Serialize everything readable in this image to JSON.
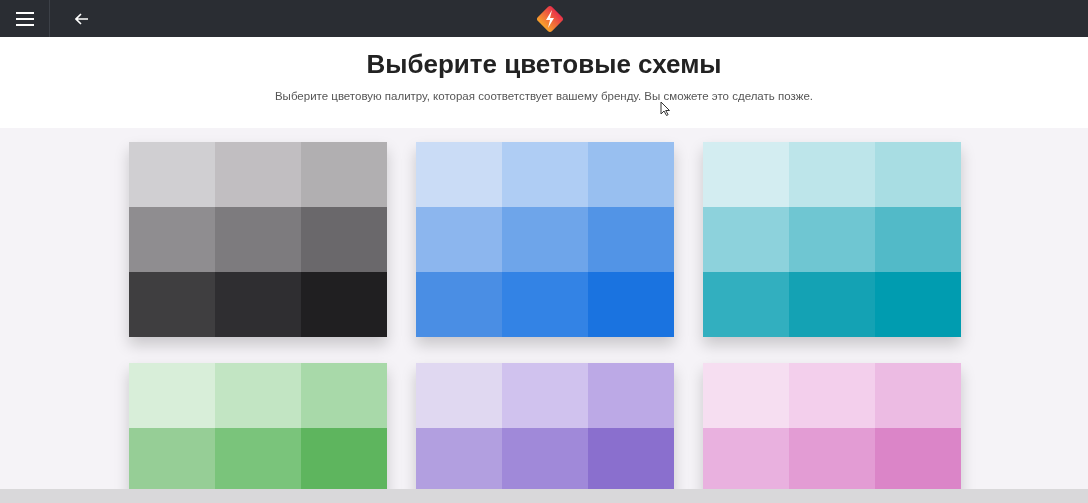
{
  "header": {
    "title": "Выберите цветовые схемы",
    "subtitle": "Выберите цветовую палитру, которая соответствует вашему бренду. Вы сможете это сделать позже."
  },
  "palettes": [
    {
      "rows": [
        [
          {
            "color": "#d0cfd2"
          },
          {
            "color": "#c1bec1"
          },
          {
            "color": "#b1afb1"
          }
        ],
        [
          {
            "color": "#8f8d90"
          },
          {
            "color": "#7d7b7e"
          },
          {
            "color": "#6a686b"
          }
        ],
        [
          {
            "color": "#3f3e40"
          },
          {
            "color": "#2f2e31"
          },
          {
            "color": "#201f21"
          }
        ]
      ]
    },
    {
      "rows": [
        [
          {
            "color": "#cadcf6"
          },
          {
            "color": "#afcdf4"
          },
          {
            "color": "#98bff0"
          }
        ],
        [
          {
            "color": "#8cb6ee"
          },
          {
            "color": "#6ea5ea"
          },
          {
            "color": "#5294e6"
          }
        ],
        [
          {
            "color": "#4a8ee4"
          },
          {
            "color": "#3383e5"
          },
          {
            "color": "#1a73e0"
          }
        ]
      ]
    },
    {
      "rows": [
        [
          {
            "color": "#d3edf1"
          },
          {
            "color": "#bde5ea"
          },
          {
            "color": "#a8dde3"
          }
        ],
        [
          {
            "color": "#8dd2dc"
          },
          {
            "color": "#6fc6d2"
          },
          {
            "color": "#52bac8"
          }
        ],
        [
          {
            "color": "#32afbf"
          },
          {
            "color": "#14a2b4"
          },
          {
            "color": "#009cb0"
          }
        ]
      ]
    },
    {
      "rows": [
        [
          {
            "color": "#d8eed9"
          },
          {
            "color": "#c2e5c3"
          },
          {
            "color": "#a8d9a9"
          }
        ],
        [
          {
            "color": "#96ce96"
          },
          {
            "color": "#7ac47b"
          },
          {
            "color": "#5eb55e"
          }
        ]
      ]
    },
    {
      "rows": [
        [
          {
            "color": "#e0d8f1"
          },
          {
            "color": "#d0c2ee"
          },
          {
            "color": "#bca9e6"
          }
        ],
        [
          {
            "color": "#b29fe0"
          },
          {
            "color": "#a089d9"
          },
          {
            "color": "#8a6fce"
          }
        ]
      ]
    },
    {
      "rows": [
        [
          {
            "color": "#f6def1"
          },
          {
            "color": "#f3cfec"
          },
          {
            "color": "#ecbbe3"
          }
        ],
        [
          {
            "color": "#e9b1df"
          },
          {
            "color": "#e39cd4"
          },
          {
            "color": "#db85c8"
          }
        ]
      ]
    }
  ]
}
